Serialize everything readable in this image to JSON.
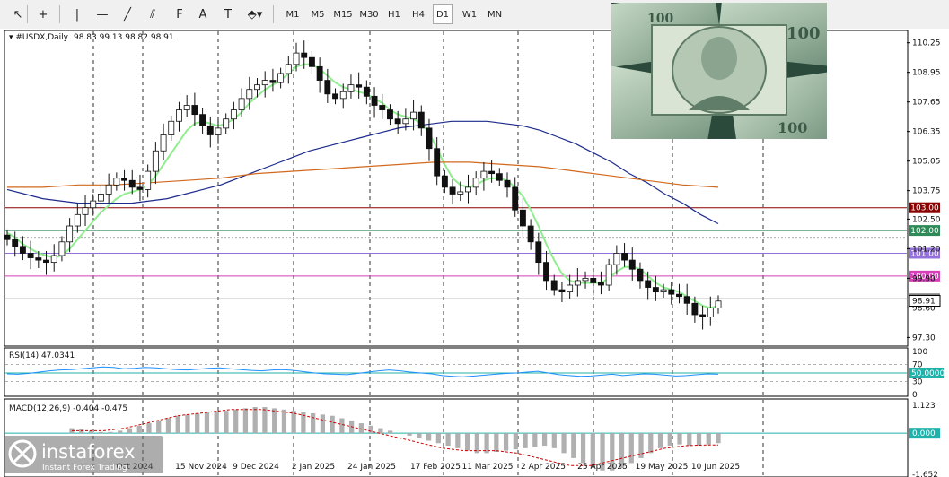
{
  "toolbar": {
    "tools": [
      {
        "name": "cursor-icon",
        "glyph": "↖"
      },
      {
        "name": "crosshair-icon",
        "glyph": "+"
      },
      {
        "name": "vertical-line-icon",
        "glyph": "|"
      },
      {
        "name": "horizontal-line-icon",
        "glyph": "—"
      },
      {
        "name": "trendline-icon",
        "glyph": "╱"
      },
      {
        "name": "channel-icon",
        "glyph": "⫽"
      },
      {
        "name": "fibonacci-icon",
        "glyph": "F"
      },
      {
        "name": "text-icon",
        "glyph": "A"
      },
      {
        "name": "text-label-icon",
        "glyph": "T"
      },
      {
        "name": "shapes-icon",
        "glyph": "⬘▾"
      }
    ],
    "timeframes": [
      "M1",
      "M5",
      "M15",
      "M30",
      "H1",
      "H4",
      "D1",
      "W1",
      "MN"
    ],
    "active_timeframe": "D1"
  },
  "header": {
    "symbol": "#USDX,Daily",
    "ohlc": "98.83 99.13 98.82 98.91"
  },
  "colors": {
    "bull": "#1a1a1a",
    "bear": "#1a1a1a",
    "ma_fast": "#90ee90",
    "ma_mid": "#1c2a8c",
    "ma_slow": "#d2691e",
    "rsi": "#1e90ff",
    "macd_hist": "#b0b0b0",
    "macd_signal": "#cc0000"
  },
  "chart_data": {
    "type": "candlestick",
    "symbol": "#USDX",
    "timeframe": "Daily",
    "ohlc_last": {
      "open": 98.83,
      "high": 99.13,
      "low": 98.82,
      "close": 98.91
    },
    "y_ticks": [
      110.25,
      108.95,
      107.65,
      106.35,
      105.05,
      103.75,
      102.5,
      101.2,
      99.9,
      98.6,
      97.3
    ],
    "ylim": [
      97.0,
      110.75
    ],
    "x_labels": [
      "Oct 2024",
      "15 Nov 2024",
      "9 Dec 2024",
      "2 Jan 2025",
      "24 Jan 2025",
      "17 Feb 2025",
      "11 Mar 2025",
      "2 Apr 2025",
      "25 Apr 2025",
      "19 May 2025",
      "10 Jun 2025"
    ],
    "close_series": [
      101.6,
      101.3,
      101.0,
      100.8,
      100.7,
      100.6,
      100.9,
      101.5,
      102.2,
      102.7,
      103.0,
      103.3,
      103.6,
      104.0,
      104.3,
      104.2,
      103.9,
      103.8,
      104.6,
      105.5,
      106.2,
      106.8,
      107.3,
      107.5,
      107.1,
      106.6,
      106.2,
      106.5,
      106.9,
      107.3,
      107.8,
      108.2,
      108.4,
      108.6,
      108.5,
      108.9,
      109.3,
      109.8,
      109.6,
      109.2,
      108.6,
      108.0,
      107.8,
      108.1,
      108.4,
      108.3,
      107.9,
      107.5,
      107.3,
      106.9,
      106.7,
      106.9,
      107.2,
      106.5,
      105.6,
      104.4,
      103.9,
      103.6,
      103.7,
      103.9,
      104.3,
      104.6,
      104.5,
      104.2,
      103.9,
      102.9,
      102.2,
      101.5,
      100.6,
      99.8,
      99.4,
      99.3,
      99.6,
      99.8,
      99.9,
      99.7,
      99.6,
      100.5,
      101.0,
      100.7,
      100.3,
      99.8,
      99.5,
      99.3,
      99.4,
      99.2,
      99.1,
      98.8,
      98.3,
      98.2,
      98.6,
      98.9
    ],
    "moving_averages": [
      {
        "period_label": "fast",
        "color": "#90ee90",
        "values": [
          101.9,
          101.7,
          101.4,
          101.2,
          101.0,
          100.9,
          100.8,
          100.9,
          101.2,
          101.6,
          102.0,
          102.4,
          102.8,
          103.1,
          103.4,
          103.6,
          103.7,
          103.8,
          104.0,
          104.4,
          104.9,
          105.4,
          105.9,
          106.4,
          106.7,
          106.8,
          106.7,
          106.6,
          106.7,
          106.9,
          107.2,
          107.6,
          107.9,
          108.2,
          108.4,
          108.6,
          108.9,
          109.2,
          109.3,
          109.3,
          109.1,
          108.8,
          108.5,
          108.3,
          108.2,
          108.1,
          108.0,
          107.8,
          107.6,
          107.3,
          107.1,
          107.0,
          106.9,
          106.7,
          106.3,
          105.6,
          104.9,
          104.3,
          104.0,
          103.9,
          104.0,
          104.2,
          104.3,
          104.3,
          104.2,
          103.9,
          103.5,
          102.9,
          102.2,
          101.4,
          100.7,
          100.1,
          99.8,
          99.7,
          99.7,
          99.7,
          99.7,
          99.9,
          100.2,
          100.4,
          100.4,
          100.3,
          100.0,
          99.7,
          99.5,
          99.4,
          99.3,
          99.1,
          98.9,
          98.7,
          98.6,
          98.7
        ]
      },
      {
        "period_label": "mid",
        "color": "#1c2a8c",
        "values": [
          103.8,
          103.6,
          103.4,
          103.3,
          103.2,
          103.2,
          103.2,
          103.2,
          103.3,
          103.4,
          103.6,
          103.8,
          104.0,
          104.3,
          104.6,
          104.9,
          105.2,
          105.5,
          105.7,
          105.9,
          106.1,
          106.3,
          106.5,
          106.6,
          106.7,
          106.8,
          106.8,
          106.8,
          106.7,
          106.6,
          106.4,
          106.1,
          105.8,
          105.4,
          105.0,
          104.5,
          104.1,
          103.6,
          103.2,
          102.7,
          102.3
        ]
      },
      {
        "period_label": "slow",
        "color": "#d2691e",
        "values": [
          103.9,
          103.9,
          104.0,
          104.0,
          104.1,
          104.2,
          104.3,
          104.5,
          104.6,
          104.7,
          104.8,
          104.9,
          105.0,
          105.0,
          104.9,
          104.8,
          104.6,
          104.4,
          104.2,
          104.0,
          103.9
        ]
      }
    ],
    "h_levels": [
      {
        "value": "103.00",
        "color": "#8b0000"
      },
      {
        "value": "102.00",
        "color": "#2e8b57"
      },
      {
        "value": "101.00",
        "color": "#9370db"
      },
      {
        "value": "100.00",
        "color": "#d63fb8"
      },
      {
        "value": "99.00",
        "color": "#808080"
      }
    ],
    "price_box_label": "98.91",
    "rsi": {
      "label": "RSI(14) 47.0341",
      "y_ticks": [
        "100",
        "70",
        "30",
        "0"
      ],
      "level_label": "50.0000",
      "values": [
        48,
        47,
        49,
        52,
        55,
        57,
        58,
        60,
        62,
        64,
        63,
        60,
        61,
        63,
        62,
        60,
        58,
        57,
        59,
        61,
        62,
        60,
        58,
        56,
        55,
        57,
        58,
        56,
        53,
        50,
        48,
        47,
        46,
        49,
        52,
        55,
        57,
        55,
        52,
        50,
        48,
        44,
        42,
        41,
        43,
        45,
        47,
        49,
        50,
        52,
        54,
        50,
        46,
        44,
        42,
        43,
        45,
        47,
        44,
        46,
        48,
        47,
        45,
        43,
        44,
        46,
        48,
        47
      ]
    },
    "macd": {
      "label": "MACD(12,26,9) -0.404 -0.475",
      "y_ticks": [
        "1.123",
        "0.000",
        "-1.652"
      ],
      "zero_label": "0.000",
      "hist": [
        0.2,
        0.15,
        0.1,
        0.05,
        0.05,
        0.1,
        0.2,
        0.3,
        0.4,
        0.5,
        0.6,
        0.7,
        0.75,
        0.8,
        0.85,
        0.9,
        0.9,
        0.95,
        1.0,
        1.05,
        1.05,
        1.0,
        0.95,
        0.9,
        0.85,
        0.8,
        0.75,
        0.7,
        0.6,
        0.5,
        0.4,
        0.3,
        0.2,
        0.1,
        0.0,
        -0.1,
        -0.2,
        -0.3,
        -0.4,
        -0.5,
        -0.6,
        -0.7,
        -0.8,
        -0.8,
        -0.75,
        -0.7,
        -0.65,
        -0.6,
        -0.55,
        -0.5,
        -0.6,
        -0.8,
        -1.0,
        -1.2,
        -1.4,
        -1.5,
        -1.5,
        -1.4,
        -1.2,
        -1.0,
        -0.8,
        -0.6,
        -0.5,
        -0.45,
        -0.5,
        -0.5,
        -0.45,
        -0.4
      ],
      "signal": [
        0.1,
        0.1,
        0.1,
        0.1,
        0.15,
        0.2,
        0.3,
        0.4,
        0.5,
        0.6,
        0.7,
        0.75,
        0.8,
        0.85,
        0.9,
        0.95,
        0.95,
        0.95,
        0.95,
        0.9,
        0.85,
        0.8,
        0.7,
        0.6,
        0.5,
        0.4,
        0.3,
        0.2,
        0.1,
        0.0,
        -0.1,
        -0.2,
        -0.3,
        -0.4,
        -0.5,
        -0.6,
        -0.65,
        -0.7,
        -0.7,
        -0.7,
        -0.7,
        -0.75,
        -0.8,
        -0.9,
        -1.0,
        -1.1,
        -1.2,
        -1.3,
        -1.3,
        -1.3,
        -1.2,
        -1.1,
        -1.0,
        -0.9,
        -0.8,
        -0.7,
        -0.6,
        -0.55,
        -0.5,
        -0.48,
        -0.47,
        -0.47
      ]
    }
  },
  "branding": {
    "name": "instaforex",
    "tagline": "Instant Forex Trading"
  }
}
